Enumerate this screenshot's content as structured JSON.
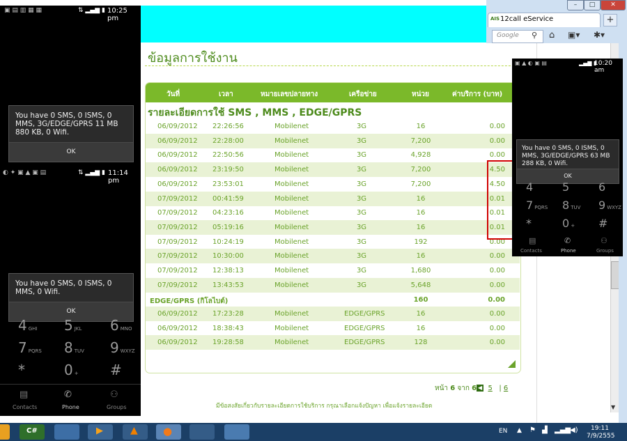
{
  "browser": {
    "tab_title": "12call eService",
    "tab_logo_text": "AIS",
    "search_placeholder": "Google",
    "window_minimize": "–",
    "window_maximize": "□",
    "window_close": "✕",
    "new_tab": "+"
  },
  "page": {
    "title": "ข้อมูลการใช้งาน",
    "section_title": "รายละเอียดการใช้ SMS , MMS , EDGE/GPRS",
    "columns": [
      "วันที่",
      "เวลา",
      "หมายเลขปลายทาง",
      "เครือข่าย",
      "หน่วย",
      "ค่าบริการ (บาท)"
    ],
    "rows_3g": [
      {
        "date": "06/09/2012",
        "time": "22:26:56",
        "dest": "Mobilenet",
        "network": "3G",
        "units": "16",
        "fee": "0.00"
      },
      {
        "date": "06/09/2012",
        "time": "22:28:00",
        "dest": "Mobilenet",
        "network": "3G",
        "units": "7,200",
        "fee": "0.00"
      },
      {
        "date": "06/09/2012",
        "time": "22:50:56",
        "dest": "Mobilenet",
        "network": "3G",
        "units": "4,928",
        "fee": "0.00"
      },
      {
        "date": "06/09/2012",
        "time": "23:19:50",
        "dest": "Mobilenet",
        "network": "3G",
        "units": "7,200",
        "fee": "4.50"
      },
      {
        "date": "06/09/2012",
        "time": "23:53:01",
        "dest": "Mobilenet",
        "network": "3G",
        "units": "7,200",
        "fee": "4.50"
      },
      {
        "date": "07/09/2012",
        "time": "00:41:59",
        "dest": "Mobilenet",
        "network": "3G",
        "units": "16",
        "fee": "0.01"
      },
      {
        "date": "07/09/2012",
        "time": "04:23:16",
        "dest": "Mobilenet",
        "network": "3G",
        "units": "16",
        "fee": "0.01"
      },
      {
        "date": "07/09/2012",
        "time": "05:19:16",
        "dest": "Mobilenet",
        "network": "3G",
        "units": "16",
        "fee": "0.01"
      },
      {
        "date": "07/09/2012",
        "time": "10:24:19",
        "dest": "Mobilenet",
        "network": "3G",
        "units": "192",
        "fee": "0.00"
      },
      {
        "date": "07/09/2012",
        "time": "10:30:00",
        "dest": "Mobilenet",
        "network": "3G",
        "units": "16",
        "fee": "0.00"
      },
      {
        "date": "07/09/2012",
        "time": "12:38:13",
        "dest": "Mobilenet",
        "network": "3G",
        "units": "1,680",
        "fee": "0.00"
      },
      {
        "date": "07/09/2012",
        "time": "13:43:53",
        "dest": "Mobilenet",
        "network": "3G",
        "units": "5,648",
        "fee": "0.00"
      }
    ],
    "subtotal": {
      "label": "EDGE/GPRS (กิโลไบต์)",
      "units": "160",
      "fee": "0.00"
    },
    "rows_edge": [
      {
        "date": "06/09/2012",
        "time": "17:23:28",
        "dest": "Mobilenet",
        "network": "EDGE/GPRS",
        "units": "16",
        "fee": "0.00"
      },
      {
        "date": "06/09/2012",
        "time": "18:38:43",
        "dest": "Mobilenet",
        "network": "EDGE/GPRS",
        "units": "16",
        "fee": "0.00"
      },
      {
        "date": "06/09/2012",
        "time": "19:28:58",
        "dest": "Mobilenet",
        "network": "EDGE/GPRS",
        "units": "128",
        "fee": "0.00"
      }
    ],
    "pager": {
      "label_page": "หน้า",
      "current": "6",
      "label_of": "จาก",
      "total": "6",
      "prev_page": "5",
      "separator": "|",
      "last_page": "6"
    },
    "footer_note": "มีข้อสงสัยเกี่ยวกับรายละเอียดการใช้บริการ กรุณาเลือกแจ้งปัญหา เพื่อแจ้งรายละเอียด"
  },
  "phone_top_left": {
    "time": "10:25 pm",
    "message": "You have 0 SMS, 0 ISMS, 0 MMS, 3G/EDGE/GPRS 11 MB 880 KB, 0 Wifi.",
    "ok": "OK"
  },
  "phone_bottom_left": {
    "time": "11:14 pm",
    "message": "You have 0 SMS, 0 ISMS, 0 MMS, 0 Wifi.",
    "ok": "OK",
    "keys": [
      {
        "digit": "4",
        "letters": "GHI"
      },
      {
        "digit": "5",
        "letters": "JKL"
      },
      {
        "digit": "6",
        "letters": "MNO"
      },
      {
        "digit": "7",
        "letters": "PQRS"
      },
      {
        "digit": "8",
        "letters": "TUV"
      },
      {
        "digit": "9",
        "letters": "WXYZ"
      },
      {
        "digit": "*",
        "letters": ""
      },
      {
        "digit": "0",
        "letters": "+"
      },
      {
        "digit": "#",
        "letters": ""
      }
    ],
    "tabs": [
      "Contacts",
      "Phone",
      "Groups"
    ]
  },
  "phone_right": {
    "time": "10:20 am",
    "message": "You have 0 SMS, 0 ISMS, 0 MMS, 3G/EDGE/GPRS 63 MB 288 KB, 0 Wifi.",
    "ok": "OK",
    "keys": [
      {
        "digit": "4",
        "letters": ""
      },
      {
        "digit": "5",
        "letters": ""
      },
      {
        "digit": "6",
        "letters": ""
      },
      {
        "digit": "7",
        "letters": "PQRS"
      },
      {
        "digit": "8",
        "letters": "TUV"
      },
      {
        "digit": "9",
        "letters": "WXYZ"
      },
      {
        "digit": "*",
        "letters": ""
      },
      {
        "digit": "0",
        "letters": "+"
      },
      {
        "digit": "#",
        "letters": ""
      }
    ],
    "tabs": [
      "Contacts",
      "Phone",
      "Groups"
    ]
  },
  "taskbar": {
    "language": "EN",
    "clock_time": "19:11",
    "clock_date": "7/9/2555"
  },
  "colors": {
    "accent_green": "#7bb92a",
    "text_green": "#6aa32a",
    "row_alt": "#e9f2d5",
    "highlight_red": "#d00000",
    "cyan_block": "#00ffff"
  }
}
